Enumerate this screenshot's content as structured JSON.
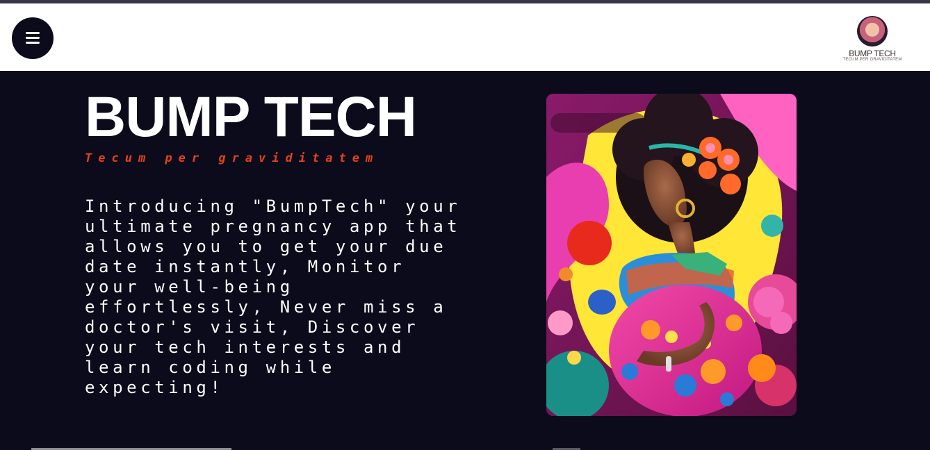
{
  "header": {
    "menu_icon": "hamburger-menu-icon",
    "logo": {
      "title": "BUMP TECH",
      "tagline": "TECUM PER GRAVIDITATEM"
    }
  },
  "hero": {
    "title": "BUMP TECH",
    "subtitle": "Tecum per graviditatem",
    "description": "Introducing \"BumpTech\" your ultimate pregnancy app that allows you to get your due date instantly, Monitor your well-being effortlessly, Never miss a doctor's visit, Discover your tech interests and learn coding while expecting!"
  },
  "colors": {
    "page_background": "#0c0b1b",
    "header_background": "#ffffff",
    "accent": "#e4421d",
    "text": "#ffffff"
  }
}
